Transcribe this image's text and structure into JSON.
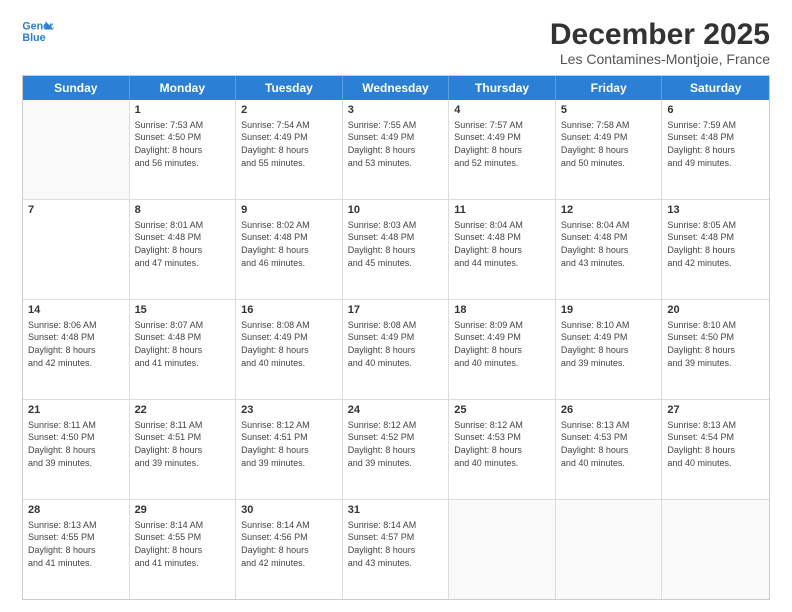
{
  "logo": {
    "line1": "General",
    "line2": "Blue"
  },
  "title": "December 2025",
  "subtitle": "Les Contamines-Montjoie, France",
  "days": [
    "Sunday",
    "Monday",
    "Tuesday",
    "Wednesday",
    "Thursday",
    "Friday",
    "Saturday"
  ],
  "weeks": [
    [
      {
        "day": "",
        "info": ""
      },
      {
        "day": "1",
        "info": "Sunrise: 7:53 AM\nSunset: 4:50 PM\nDaylight: 8 hours\nand 56 minutes."
      },
      {
        "day": "2",
        "info": "Sunrise: 7:54 AM\nSunset: 4:49 PM\nDaylight: 8 hours\nand 55 minutes."
      },
      {
        "day": "3",
        "info": "Sunrise: 7:55 AM\nSunset: 4:49 PM\nDaylight: 8 hours\nand 53 minutes."
      },
      {
        "day": "4",
        "info": "Sunrise: 7:57 AM\nSunset: 4:49 PM\nDaylight: 8 hours\nand 52 minutes."
      },
      {
        "day": "5",
        "info": "Sunrise: 7:58 AM\nSunset: 4:49 PM\nDaylight: 8 hours\nand 50 minutes."
      },
      {
        "day": "6",
        "info": "Sunrise: 7:59 AM\nSunset: 4:48 PM\nDaylight: 8 hours\nand 49 minutes."
      }
    ],
    [
      {
        "day": "7",
        "info": ""
      },
      {
        "day": "8",
        "info": "Sunrise: 8:01 AM\nSunset: 4:48 PM\nDaylight: 8 hours\nand 47 minutes."
      },
      {
        "day": "9",
        "info": "Sunrise: 8:02 AM\nSunset: 4:48 PM\nDaylight: 8 hours\nand 46 minutes."
      },
      {
        "day": "10",
        "info": "Sunrise: 8:03 AM\nSunset: 4:48 PM\nDaylight: 8 hours\nand 45 minutes."
      },
      {
        "day": "11",
        "info": "Sunrise: 8:04 AM\nSunset: 4:48 PM\nDaylight: 8 hours\nand 44 minutes."
      },
      {
        "day": "12",
        "info": "Sunrise: 8:04 AM\nSunset: 4:48 PM\nDaylight: 8 hours\nand 43 minutes."
      },
      {
        "day": "13",
        "info": "Sunrise: 8:05 AM\nSunset: 4:48 PM\nDaylight: 8 hours\nand 42 minutes."
      }
    ],
    [
      {
        "day": "14",
        "info": "Sunrise: 8:06 AM\nSunset: 4:48 PM\nDaylight: 8 hours\nand 42 minutes."
      },
      {
        "day": "15",
        "info": "Sunrise: 8:07 AM\nSunset: 4:48 PM\nDaylight: 8 hours\nand 41 minutes."
      },
      {
        "day": "16",
        "info": "Sunrise: 8:08 AM\nSunset: 4:49 PM\nDaylight: 8 hours\nand 40 minutes."
      },
      {
        "day": "17",
        "info": "Sunrise: 8:08 AM\nSunset: 4:49 PM\nDaylight: 8 hours\nand 40 minutes."
      },
      {
        "day": "18",
        "info": "Sunrise: 8:09 AM\nSunset: 4:49 PM\nDaylight: 8 hours\nand 40 minutes."
      },
      {
        "day": "19",
        "info": "Sunrise: 8:10 AM\nSunset: 4:49 PM\nDaylight: 8 hours\nand 39 minutes."
      },
      {
        "day": "20",
        "info": "Sunrise: 8:10 AM\nSunset: 4:50 PM\nDaylight: 8 hours\nand 39 minutes."
      }
    ],
    [
      {
        "day": "21",
        "info": "Sunrise: 8:11 AM\nSunset: 4:50 PM\nDaylight: 8 hours\nand 39 minutes."
      },
      {
        "day": "22",
        "info": "Sunrise: 8:11 AM\nSunset: 4:51 PM\nDaylight: 8 hours\nand 39 minutes."
      },
      {
        "day": "23",
        "info": "Sunrise: 8:12 AM\nSunset: 4:51 PM\nDaylight: 8 hours\nand 39 minutes."
      },
      {
        "day": "24",
        "info": "Sunrise: 8:12 AM\nSunset: 4:52 PM\nDaylight: 8 hours\nand 39 minutes."
      },
      {
        "day": "25",
        "info": "Sunrise: 8:12 AM\nSunset: 4:53 PM\nDaylight: 8 hours\nand 40 minutes."
      },
      {
        "day": "26",
        "info": "Sunrise: 8:13 AM\nSunset: 4:53 PM\nDaylight: 8 hours\nand 40 minutes."
      },
      {
        "day": "27",
        "info": "Sunrise: 8:13 AM\nSunset: 4:54 PM\nDaylight: 8 hours\nand 40 minutes."
      }
    ],
    [
      {
        "day": "28",
        "info": "Sunrise: 8:13 AM\nSunset: 4:55 PM\nDaylight: 8 hours\nand 41 minutes."
      },
      {
        "day": "29",
        "info": "Sunrise: 8:14 AM\nSunset: 4:55 PM\nDaylight: 8 hours\nand 41 minutes."
      },
      {
        "day": "30",
        "info": "Sunrise: 8:14 AM\nSunset: 4:56 PM\nDaylight: 8 hours\nand 42 minutes."
      },
      {
        "day": "31",
        "info": "Sunrise: 8:14 AM\nSunset: 4:57 PM\nDaylight: 8 hours\nand 43 minutes."
      },
      {
        "day": "",
        "info": ""
      },
      {
        "day": "",
        "info": ""
      },
      {
        "day": "",
        "info": ""
      }
    ]
  ]
}
